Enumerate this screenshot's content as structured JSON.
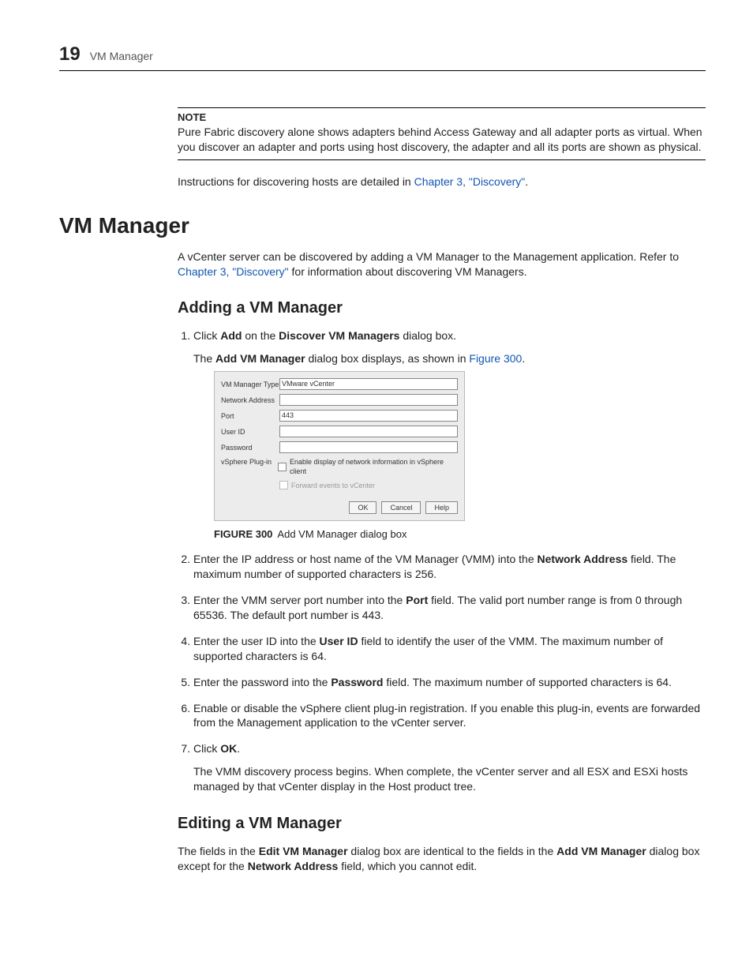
{
  "header": {
    "chapter_num": "19",
    "title": "VM Manager"
  },
  "note": {
    "label": "NOTE",
    "body": "Pure Fabric discovery alone shows adapters behind Access Gateway and all adapter ports as virtual. When you discover an adapter and ports using host discovery, the adapter and all its ports are shown as physical."
  },
  "intro_line": {
    "text_before": "Instructions for discovering hosts are detailed in ",
    "link": "Chapter 3, \"Discovery\"",
    "text_after": "."
  },
  "h1": "VM Manager",
  "vcenter_para": {
    "part1": "A vCenter server can be discovered by adding a VM Manager to the Management application. Refer to ",
    "link": "Chapter 3, \"Discovery\"",
    "part2": " for information about discovering VM Managers."
  },
  "h2_add": "Adding a VM Manager",
  "step1": {
    "pre": "Click ",
    "bold1": "Add",
    "mid": " on the ",
    "bold2": "Discover VM Managers",
    "post": " dialog box."
  },
  "step1_body": {
    "pre": "The ",
    "bold": "Add VM Manager",
    "mid": " dialog box displays, as shown in ",
    "link": "Figure 300",
    "post": "."
  },
  "dialog": {
    "labels": {
      "type": "VM Manager Type",
      "addr": "Network Address",
      "port": "Port",
      "user": "User ID",
      "pass": "Password",
      "plugin": "vSphere Plug-in"
    },
    "type_value": "VMware vCenter",
    "port_value": "443",
    "check1": "Enable display of network information in vSphere client",
    "check2": "Forward events to vCenter",
    "buttons": {
      "ok": "OK",
      "cancel": "Cancel",
      "help": "Help"
    }
  },
  "figure": {
    "num": "FIGURE 300",
    "caption": "Add VM Manager dialog box"
  },
  "step2": {
    "pre": "Enter the IP address or host name of the VM Manager (VMM) into the ",
    "bold": "Network Address",
    "post": " field. The maximum number of supported characters is 256."
  },
  "step3": {
    "pre": "Enter the VMM server port number into the ",
    "bold": "Port",
    "post": " field. The valid port number range is from 0 through 65536. The default port number is 443."
  },
  "step4": {
    "pre": "Enter the user ID into the ",
    "bold": "User ID",
    "post": " field to identify the user of the VMM. The maximum number of supported characters is 64."
  },
  "step5": {
    "pre": "Enter the password into the ",
    "bold": "Password",
    "post": " field. The maximum number of supported characters is 64."
  },
  "step6": "Enable or disable the vSphere client plug-in registration. If you enable this plug-in, events are forwarded from the Management application to the vCenter server.",
  "step7": {
    "pre": "Click ",
    "bold": "OK",
    "post": "."
  },
  "step7_body": "The VMM discovery process begins. When complete, the vCenter server and all ESX and ESXi hosts managed by that vCenter display in the Host product tree.",
  "h2_edit": "Editing a VM Manager",
  "edit_para": {
    "p1": "The fields in the ",
    "b1": "Edit VM Manager",
    "p2": " dialog box are identical to the fields in the ",
    "b2": "Add VM Manager",
    "p3": " dialog box except for the ",
    "b3": "Network Address",
    "p4": " field, which you cannot edit."
  }
}
